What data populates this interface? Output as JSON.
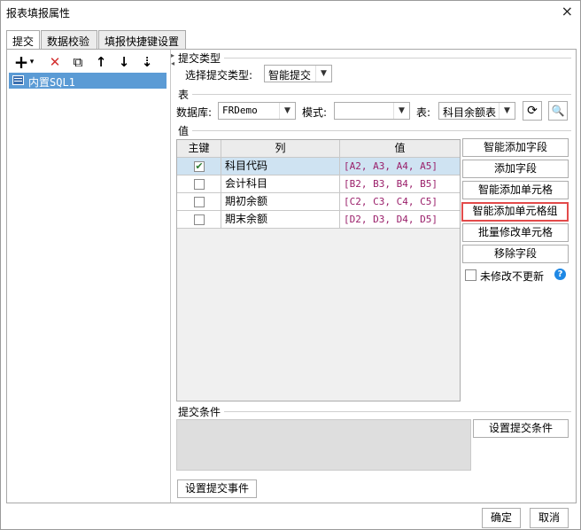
{
  "window": {
    "title": "报表填报属性",
    "close_icon": "×"
  },
  "tabs": [
    {
      "label": "提交",
      "active": true
    },
    {
      "label": "数据校验",
      "active": false
    },
    {
      "label": "填报快捷键设置",
      "active": false
    }
  ],
  "toolbar": {
    "add": "+",
    "add_caret": "▾",
    "delete": "✕",
    "copy": "⧉",
    "up": "↑",
    "down": "↓",
    "sort": "⇣"
  },
  "tree": {
    "items": [
      {
        "label": "内置SQL1"
      }
    ]
  },
  "submit_type": {
    "section": "提交类型",
    "label": "选择提交类型:",
    "value": "智能提交"
  },
  "table_section": {
    "section": "表",
    "db_label": "数据库:",
    "db_value": "FRDemo",
    "mode_label": "模式:",
    "mode_value": "",
    "table_label": "表:",
    "table_value": "科目余额表"
  },
  "value_section": {
    "section": "值",
    "columns": [
      "主键",
      "列",
      "值"
    ],
    "rows": [
      {
        "key": true,
        "col": "科目代码",
        "val": "[A2, A3, A4, A5]"
      },
      {
        "key": false,
        "col": "会计科目",
        "val": "[B2, B3, B4, B5]"
      },
      {
        "key": false,
        "col": "期初余额",
        "val": "[C2, C3, C4, C5]"
      },
      {
        "key": false,
        "col": "期末余额",
        "val": "[D2, D3, D4, D5]"
      }
    ]
  },
  "side_buttons": {
    "smart_add_field": "智能添加字段",
    "add_field": "添加字段",
    "smart_add_cell": "智能添加单元格",
    "smart_add_cell_group": "智能添加单元格组",
    "batch_modify_cell": "批量修改单元格",
    "remove_field": "移除字段",
    "no_update_label": "未修改不更新",
    "help": "?"
  },
  "submit_condition": {
    "section": "提交条件",
    "button": "设置提交条件"
  },
  "submit_event_button": "设置提交事件",
  "footer": {
    "ok": "确定",
    "cancel": "取消"
  },
  "colors": {
    "selection": "#5b9bd5",
    "row_selected": "#cfe3f2",
    "highlight_border": "#e34a4a",
    "value_text": "#9a1f6a"
  }
}
